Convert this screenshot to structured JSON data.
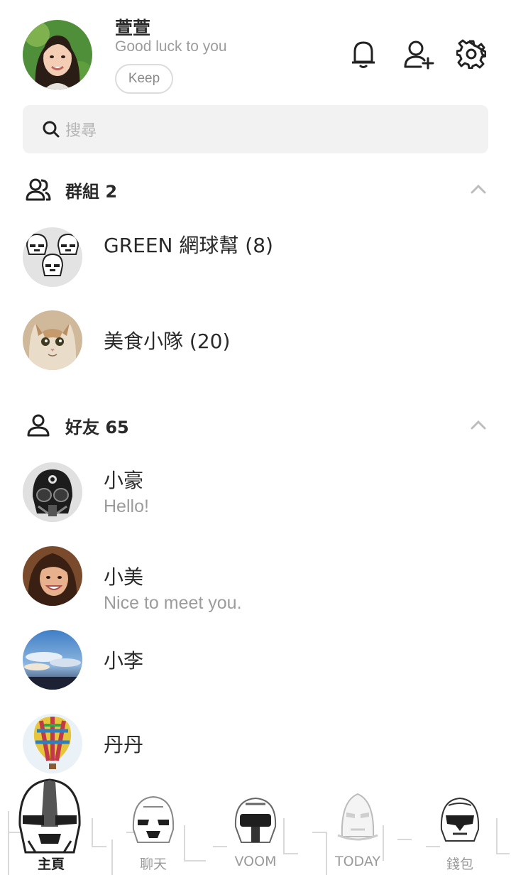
{
  "profile": {
    "name": "萱萱",
    "status": "Good luck to you",
    "keep_label": "Keep"
  },
  "header_icons": [
    "bell-icon",
    "add-friend-icon",
    "gear-icon"
  ],
  "search": {
    "placeholder": "搜尋"
  },
  "groups": {
    "title": "群組 2",
    "items": [
      {
        "name": "GREEN 網球幫 (8)"
      },
      {
        "name": "美食小隊 (20)"
      }
    ]
  },
  "friends": {
    "title": "好友 65",
    "items": [
      {
        "name": "小豪",
        "status": "Hello!"
      },
      {
        "name": "小美",
        "status": "Nice to meet you."
      },
      {
        "name": "小李",
        "status": ""
      },
      {
        "name": "丹丹",
        "status": ""
      }
    ]
  },
  "bottom_nav": {
    "items": [
      {
        "label": "主頁",
        "active": true
      },
      {
        "label": "聊天",
        "active": false
      },
      {
        "label": "VOOM",
        "active": false
      },
      {
        "label": "TODAY",
        "active": false
      },
      {
        "label": "錢包",
        "active": false
      }
    ]
  },
  "colors": {
    "text_primary": "#2a2a2a",
    "text_secondary": "#9c9c9c",
    "search_bg": "#f2f2f2",
    "nav_active": "#1e1e1e",
    "nav_inactive": "#9a9a9a"
  }
}
